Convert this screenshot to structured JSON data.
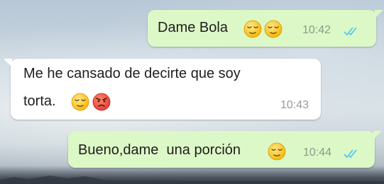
{
  "messages": [
    {
      "direction": "outgoing",
      "text": "Dame Bola",
      "emojis": [
        "relieved-face-icon",
        "relieved-face-icon"
      ],
      "time": "10:42",
      "status": "read"
    },
    {
      "direction": "incoming",
      "line1": "Me he cansado de decirte que soy",
      "line2": "torta.",
      "emojis": [
        "relieved-face-icon",
        "pouting-face-icon"
      ],
      "time": "10:43"
    },
    {
      "direction": "outgoing",
      "text": "Bueno,dame  una porción",
      "emojis": [
        "relieved-face-icon"
      ],
      "time": "10:44",
      "status": "read"
    }
  ],
  "colors": {
    "outgoing_bubble": "#dcf8c6",
    "incoming_bubble": "#ffffff",
    "read_ticks": "#4fc3f7"
  }
}
